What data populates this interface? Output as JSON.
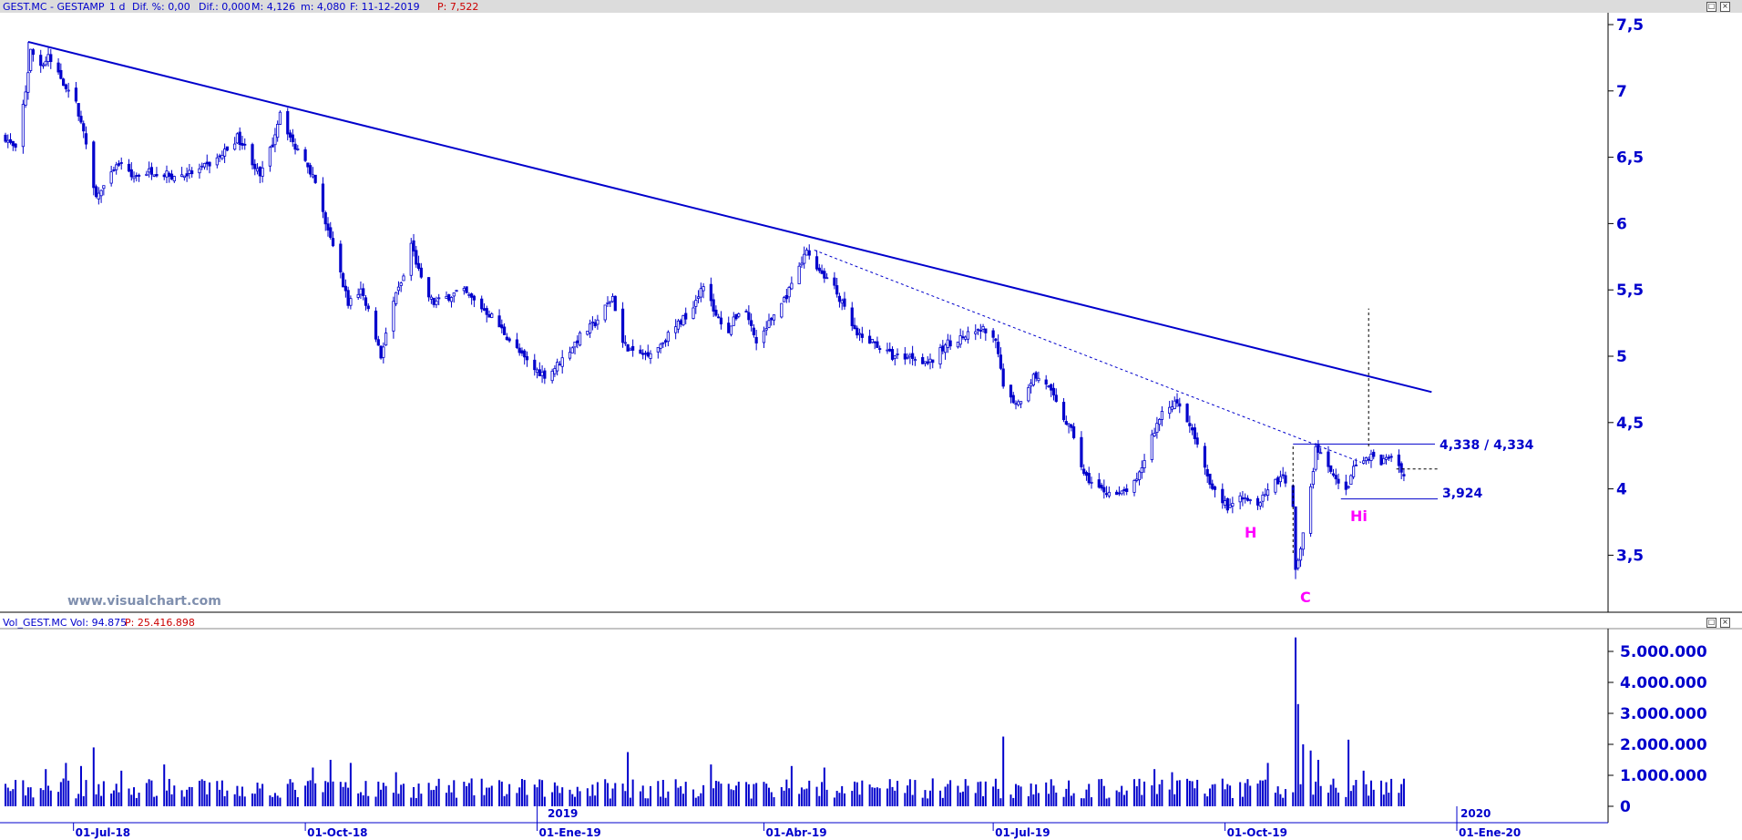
{
  "header": {
    "symbol": "GEST.MC - GESTAMP",
    "period": "1 d",
    "dif_pct": "Dif. %: 0,00",
    "dif": "Dif.: 0,000",
    "max": "M: 4,126",
    "min": "m: 4,080",
    "date": "F: 11-12-2019",
    "price": "P: 7,522"
  },
  "volume_header": {
    "name": "Vol_GEST.MC",
    "vol": "Vol: 94.875",
    "p": "P: 25.416.898"
  },
  "watermark": "www.visualchart.com",
  "colors": {
    "series": "#0000cc",
    "annotation": "#ff00ff",
    "header_bg": "#dcdcdc",
    "price_red": "#cc0000",
    "watermark": "#7f8fae"
  },
  "chart_data": [
    {
      "type": "candlestick",
      "x_range": [
        "2018-06-04",
        "2019-12-11"
      ],
      "ylim": [
        3.1,
        7.6
      ],
      "y_ticks": [
        "7,5",
        "7",
        "6,5",
        "6",
        "5,5",
        "5",
        "4,5",
        "4",
        "3,5"
      ],
      "x_ticks": [
        "01-Jul-18",
        "01-Oct-18",
        "01-Ene-19",
        "01-Abr-19",
        "01-Jul-19",
        "01-Oct-19",
        "01-Ene-20"
      ],
      "year_labels": [
        "2019",
        "2020"
      ],
      "close_path": [
        [
          "2018-06-04",
          6.65
        ],
        [
          "2018-06-08",
          6.55
        ],
        [
          "2018-06-12",
          7.0
        ],
        [
          "2018-06-14",
          7.3
        ],
        [
          "2018-06-18",
          7.2
        ],
        [
          "2018-06-21",
          7.25
        ],
        [
          "2018-06-26",
          7.1
        ],
        [
          "2018-07-02",
          6.9
        ],
        [
          "2018-07-06",
          6.6
        ],
        [
          "2018-07-10",
          6.2
        ],
        [
          "2018-07-14",
          6.3
        ],
        [
          "2018-07-19",
          6.45
        ],
        [
          "2018-07-24",
          6.35
        ],
        [
          "2018-08-01",
          6.4
        ],
        [
          "2018-08-10",
          6.35
        ],
        [
          "2018-08-20",
          6.4
        ],
        [
          "2018-08-28",
          6.5
        ],
        [
          "2018-09-04",
          6.65
        ],
        [
          "2018-09-08",
          6.55
        ],
        [
          "2018-09-13",
          6.35
        ],
        [
          "2018-09-18",
          6.6
        ],
        [
          "2018-09-21",
          6.85
        ],
        [
          "2018-09-26",
          6.6
        ],
        [
          "2018-10-01",
          6.5
        ],
        [
          "2018-10-05",
          6.3
        ],
        [
          "2018-10-09",
          6.0
        ],
        [
          "2018-10-14",
          5.7
        ],
        [
          "2018-10-18",
          5.4
        ],
        [
          "2018-10-23",
          5.5
        ],
        [
          "2018-10-27",
          5.3
        ],
        [
          "2018-10-31",
          5.0
        ],
        [
          "2018-11-04",
          5.35
        ],
        [
          "2018-11-09",
          5.6
        ],
        [
          "2018-11-12",
          5.85
        ],
        [
          "2018-11-17",
          5.5
        ],
        [
          "2018-11-21",
          5.4
        ],
        [
          "2018-11-27",
          5.45
        ],
        [
          "2018-12-02",
          5.5
        ],
        [
          "2018-12-08",
          5.4
        ],
        [
          "2018-12-14",
          5.3
        ],
        [
          "2018-12-20",
          5.15
        ],
        [
          "2018-12-26",
          5.0
        ],
        [
          "2018-12-31",
          4.9
        ],
        [
          "2019-01-05",
          4.85
        ],
        [
          "2019-01-12",
          5.0
        ],
        [
          "2019-01-18",
          5.15
        ],
        [
          "2019-01-24",
          5.25
        ],
        [
          "2019-01-31",
          5.45
        ],
        [
          "2019-02-04",
          5.1
        ],
        [
          "2019-02-10",
          5.0
        ],
        [
          "2019-02-17",
          5.05
        ],
        [
          "2019-02-24",
          5.2
        ],
        [
          "2019-03-03",
          5.35
        ],
        [
          "2019-03-08",
          5.55
        ],
        [
          "2019-03-13",
          5.3
        ],
        [
          "2019-03-18",
          5.2
        ],
        [
          "2019-03-24",
          5.4
        ],
        [
          "2019-03-29",
          5.1
        ],
        [
          "2019-04-03",
          5.25
        ],
        [
          "2019-04-08",
          5.4
        ],
        [
          "2019-04-13",
          5.55
        ],
        [
          "2019-04-18",
          5.8
        ],
        [
          "2019-04-23",
          5.65
        ],
        [
          "2019-04-28",
          5.55
        ],
        [
          "2019-05-03",
          5.35
        ],
        [
          "2019-05-08",
          5.15
        ],
        [
          "2019-05-15",
          5.1
        ],
        [
          "2019-05-22",
          5.0
        ],
        [
          "2019-05-30",
          5.0
        ],
        [
          "2019-06-06",
          4.95
        ],
        [
          "2019-06-13",
          5.1
        ],
        [
          "2019-06-20",
          5.15
        ],
        [
          "2019-06-27",
          5.2
        ],
        [
          "2019-07-02",
          5.1
        ],
        [
          "2019-07-06",
          4.7
        ],
        [
          "2019-07-11",
          4.65
        ],
        [
          "2019-07-17",
          4.85
        ],
        [
          "2019-07-22",
          4.8
        ],
        [
          "2019-07-27",
          4.6
        ],
        [
          "2019-08-02",
          4.4
        ],
        [
          "2019-08-06",
          4.1
        ],
        [
          "2019-08-12",
          4.0
        ],
        [
          "2019-08-20",
          3.95
        ],
        [
          "2019-08-27",
          4.05
        ],
        [
          "2019-09-02",
          4.4
        ],
        [
          "2019-09-07",
          4.6
        ],
        [
          "2019-09-12",
          4.65
        ],
        [
          "2019-09-16",
          4.5
        ],
        [
          "2019-09-20",
          4.35
        ],
        [
          "2019-09-24",
          4.1
        ],
        [
          "2019-09-28",
          3.95
        ],
        [
          "2019-10-03",
          3.85
        ],
        [
          "2019-10-08",
          3.95
        ],
        [
          "2019-10-14",
          3.9
        ],
        [
          "2019-10-21",
          4.05
        ],
        [
          "2019-10-24",
          4.1
        ],
        [
          "2019-10-28",
          3.85
        ],
        [
          "2019-10-29",
          3.4
        ],
        [
          "2019-10-31",
          3.55
        ],
        [
          "2019-11-03",
          3.85
        ],
        [
          "2019-11-06",
          4.3
        ],
        [
          "2019-11-10",
          4.2
        ],
        [
          "2019-11-14",
          4.05
        ],
        [
          "2019-11-18",
          3.98
        ],
        [
          "2019-11-22",
          4.2
        ],
        [
          "2019-11-27",
          4.25
        ],
        [
          "2019-12-02",
          4.2
        ],
        [
          "2019-12-06",
          4.25
        ],
        [
          "2019-12-10",
          4.15
        ],
        [
          "2019-12-11",
          4.1
        ]
      ],
      "trendline": {
        "from": [
          "2018-06-13",
          7.37
        ],
        "to": [
          "2019-12-22",
          4.73
        ]
      },
      "dotted_trendline": {
        "from": [
          "2019-04-21",
          5.8
        ],
        "to": [
          "2019-11-24",
          4.2
        ]
      },
      "resistance": {
        "value": 4.338,
        "label": "4,338 / 4,334"
      },
      "support": {
        "value": 3.924,
        "label": "3,924"
      },
      "target_line": {
        "date": "2019-11-27",
        "from": 4.32,
        "to": 5.36
      },
      "annotations": [
        {
          "label": "H",
          "date": "2019-10-08",
          "value": 3.73
        },
        {
          "label": "Hi",
          "date": "2019-11-20",
          "value": 3.86
        },
        {
          "label": "C",
          "date": "2019-10-29",
          "value": 3.12
        }
      ]
    },
    {
      "type": "bar",
      "ylim": [
        0,
        5600000
      ],
      "y_ticks": [
        "5.000.000",
        "4.000.000",
        "3.000.000",
        "2.000.000",
        "1.000.000",
        "0"
      ],
      "spikes": [
        [
          "2018-06-20",
          1200000
        ],
        [
          "2018-06-28",
          1400000
        ],
        [
          "2018-07-04",
          1300000
        ],
        [
          "2018-07-09",
          1900000
        ],
        [
          "2018-07-20",
          1150000
        ],
        [
          "2018-08-06",
          1350000
        ],
        [
          "2018-10-04",
          1250000
        ],
        [
          "2018-10-11",
          1500000
        ],
        [
          "2018-10-19",
          1400000
        ],
        [
          "2018-11-06",
          1100000
        ],
        [
          "2019-02-06",
          1750000
        ],
        [
          "2019-03-11",
          1350000
        ],
        [
          "2019-04-12",
          1300000
        ],
        [
          "2019-04-25",
          1250000
        ],
        [
          "2019-07-05",
          2250000
        ],
        [
          "2019-09-03",
          1200000
        ],
        [
          "2019-09-10",
          1100000
        ],
        [
          "2019-10-18",
          1400000
        ],
        [
          "2019-10-29",
          5450000
        ],
        [
          "2019-10-30",
          3300000
        ],
        [
          "2019-11-01",
          2000000
        ],
        [
          "2019-11-04",
          1800000
        ],
        [
          "2019-11-07",
          1500000
        ],
        [
          "2019-11-19",
          2150000
        ],
        [
          "2019-11-25",
          1150000
        ]
      ]
    }
  ]
}
